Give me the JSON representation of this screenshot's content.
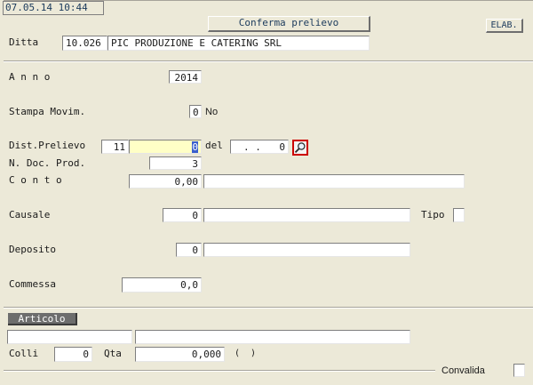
{
  "header": {
    "timestamp": "07.05.14 10:44",
    "confirm_button": "Conferma prelievo",
    "elab_button": "ELAB."
  },
  "ditta": {
    "label": "Ditta",
    "code": "10.026",
    "name": "PIC PRODUZIONE E CATERING SRL"
  },
  "form": {
    "anno_label": "A n n o",
    "anno_value": "2014",
    "stampa_label": "Stampa Movim.",
    "stampa_value": "0",
    "stampa_text": "No",
    "dist_label": "Dist.Prelievo",
    "dist_prefix": "11",
    "dist_number": "0",
    "del_label": "del",
    "del_date": " . .",
    "del_value": "0",
    "ndoc_label": "N. Doc. Prod.",
    "ndoc_value": "3",
    "conto_label": "C o n t o",
    "conto_value": "0,00",
    "conto_desc": "",
    "causale_label": "Causale",
    "causale_value": "0",
    "causale_desc": "",
    "tipo_label": "Tipo",
    "tipo_value": "",
    "deposito_label": "Deposito",
    "deposito_value": "0",
    "deposito_desc": "",
    "commessa_label": "Commessa",
    "commessa_value": "0,0"
  },
  "articolo": {
    "section_label": "Articolo",
    "code": "",
    "description": "",
    "colli_label": "Colli",
    "colli_value": "0",
    "qta_label": "Qta",
    "qta_value": "0,000",
    "unit_text": "(  )",
    "convalida_label": "Convalida"
  },
  "icons": {
    "search": "magnifier-icon"
  }
}
